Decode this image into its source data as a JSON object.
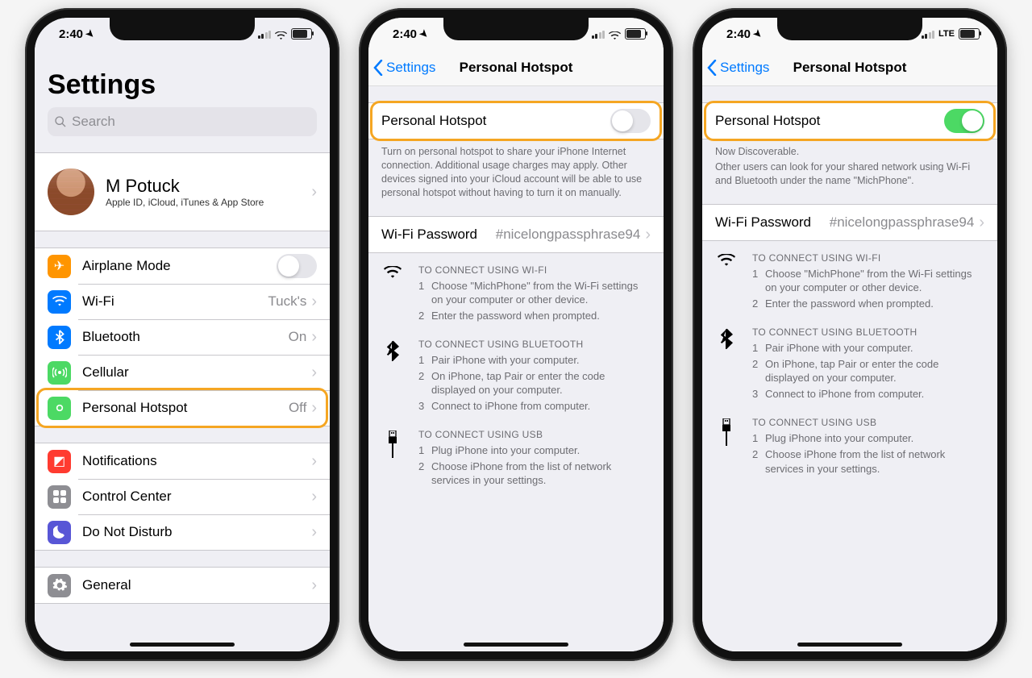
{
  "status": {
    "time": "2:40",
    "carrier_lte": "LTE"
  },
  "phone1": {
    "large_title": "Settings",
    "search_placeholder": "Search",
    "profile": {
      "name": "M Potuck",
      "sub": "Apple ID, iCloud, iTunes & App Store"
    },
    "rows": {
      "airplane": "Airplane Mode",
      "wifi": {
        "label": "Wi-Fi",
        "value": "Tuck's"
      },
      "bt": {
        "label": "Bluetooth",
        "value": "On"
      },
      "cellular": "Cellular",
      "hotspot": {
        "label": "Personal Hotspot",
        "value": "Off"
      },
      "notif": "Notifications",
      "cc": "Control Center",
      "dnd": "Do Not Disturb",
      "general": "General"
    }
  },
  "hotspot": {
    "back": "Settings",
    "title": "Personal Hotspot",
    "toggle_label": "Personal Hotspot",
    "off_help": "Turn on personal hotspot to share your iPhone Internet connection. Additional usage charges may apply. Other devices signed into your iCloud account will be able to use personal hotspot without having to turn it on manually.",
    "on_help_1": "Now Discoverable.",
    "on_help_2": "Other users can look for your shared network using Wi-Fi and Bluetooth under the name \"MichPhone\".",
    "wifi_pw_label": "Wi-Fi Password",
    "wifi_pw_value": "#nicelongpassphrase94",
    "instr": {
      "wifi": {
        "title": "TO CONNECT USING WI-FI",
        "s1": "Choose \"MichPhone\" from the Wi-Fi settings on your computer or other device.",
        "s2": "Enter the password when prompted."
      },
      "bt": {
        "title": "TO CONNECT USING BLUETOOTH",
        "s1": "Pair iPhone with your computer.",
        "s2": "On iPhone, tap Pair or enter the code displayed on your computer.",
        "s3": "Connect to iPhone from computer."
      },
      "usb": {
        "title": "TO CONNECT USING USB",
        "s1": "Plug iPhone into your computer.",
        "s2": "Choose iPhone from the list of network services in your settings."
      }
    }
  },
  "colors": {
    "airplane": "#ff9500",
    "wifi": "#007aff",
    "bt": "#007aff",
    "cellular": "#4cd964",
    "hotspot": "#4cd964",
    "notif": "#ff3b30",
    "cc": "#8e8e93",
    "dnd": "#5856d6",
    "general": "#8e8e93"
  }
}
